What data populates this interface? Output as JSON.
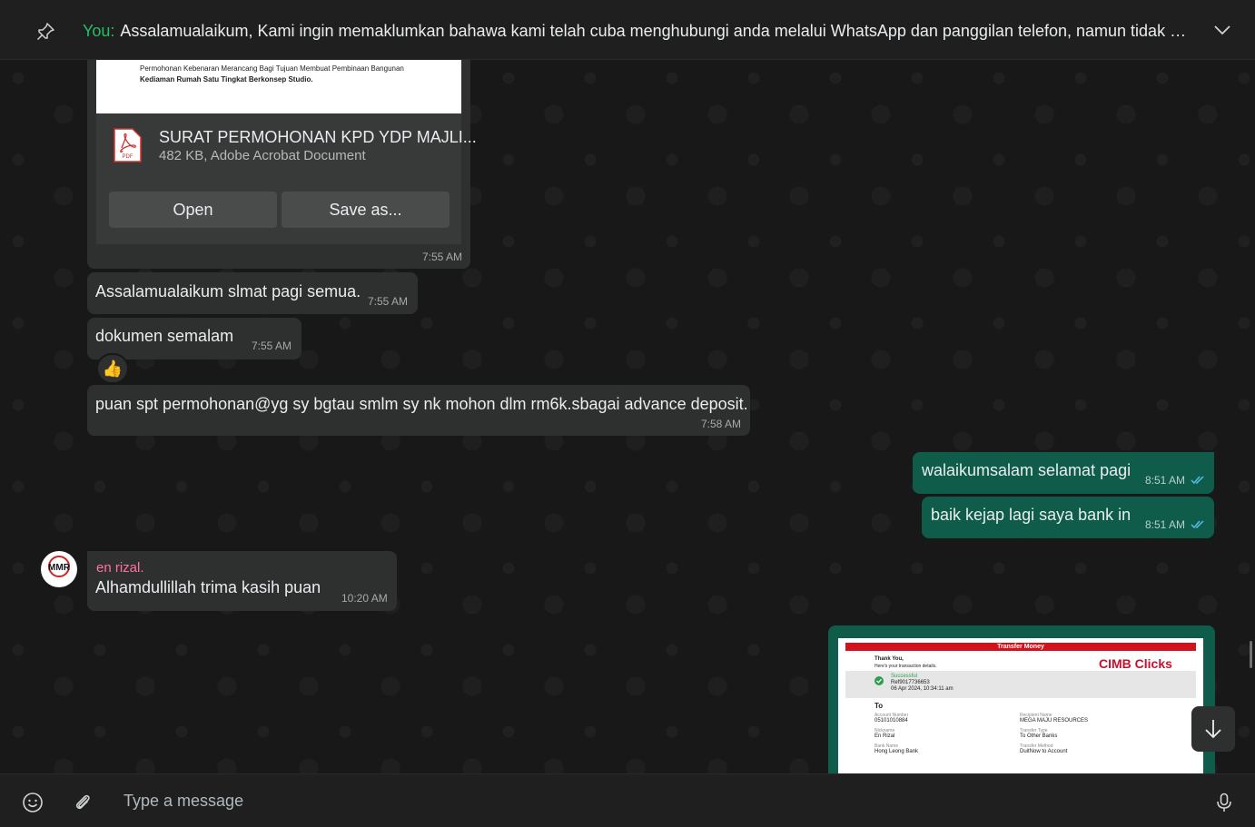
{
  "pinned": {
    "sender_label": "You:",
    "text": "Assalamualaikum,  Kami ingin memaklumkan bahawa kami telah cuba menghubungi anda melalui WhatsApp dan panggilan telefon, namun tidak menerima sebarang maklum balas."
  },
  "document": {
    "preview_line1": "Permohonan Kebenaran Merancang Bagi Tujuan Membuat Pembinaan Bangunan",
    "preview_line2": "Kediaman Rumah Satu Tingkat Berkonsep Studio.",
    "name": "SURAT PERMOHONAN KPD YDP MAJLI...",
    "meta": "482 KB, Adobe Acrobat Document",
    "open_label": "Open",
    "save_label": "Save as...",
    "time": "7:55 AM",
    "icon_label": "PDF"
  },
  "messages": [
    {
      "text": "Assalamualaikum slmat pagi semua.",
      "time": "7:55 AM"
    },
    {
      "text": "dokumen semalam",
      "time": "7:55 AM",
      "reaction": "👍"
    },
    {
      "text": "puan spt permohonan@yg sy bgtau smlm sy nk mohon dlm rm6k.sbagai advance deposit.",
      "time": "7:58 AM"
    },
    {
      "text": "walaikumsalam selamat pagi",
      "time": "8:51 AM"
    },
    {
      "text": "baik kejap lagi saya bank in",
      "time": "8:51 AM"
    },
    {
      "sender": "en rizal.",
      "text": "Alhamdullillah trima kasih puan",
      "time": "10:20 AM"
    }
  ],
  "avatar_text": "MMR",
  "receipt": {
    "header": "Transfer Money",
    "thank_you": "Thank You,",
    "subtitle": "Here's your transaction details.",
    "brand": "CIMB Clicks",
    "status": "Successful",
    "ref": "Ref9017736653",
    "date": "06 Apr 2024, 10:34:11 am",
    "to_label": "To",
    "account_number_label": "Account Number",
    "account_number": "05101010884",
    "recipient_label": "Recipient Name",
    "recipient": "MEGA MAJU RESOURCES",
    "nickname_label": "Nickname",
    "nickname": "En Rizal",
    "transfer_type_label": "Transfer Type",
    "transfer_type": "To Other Banks",
    "bank_label": "Bank Name",
    "bank": "Hong Leong Bank",
    "method_label": "Transfer Method",
    "method": "DuitNow to Account"
  },
  "composer": {
    "placeholder": "Type a message"
  },
  "colors": {
    "accent": "#21c063",
    "outgoing": "#0f5c4b",
    "incoming": "#2e2f2f",
    "sender_name": "#ff72a1",
    "read_ticks": "#53bdeb"
  }
}
